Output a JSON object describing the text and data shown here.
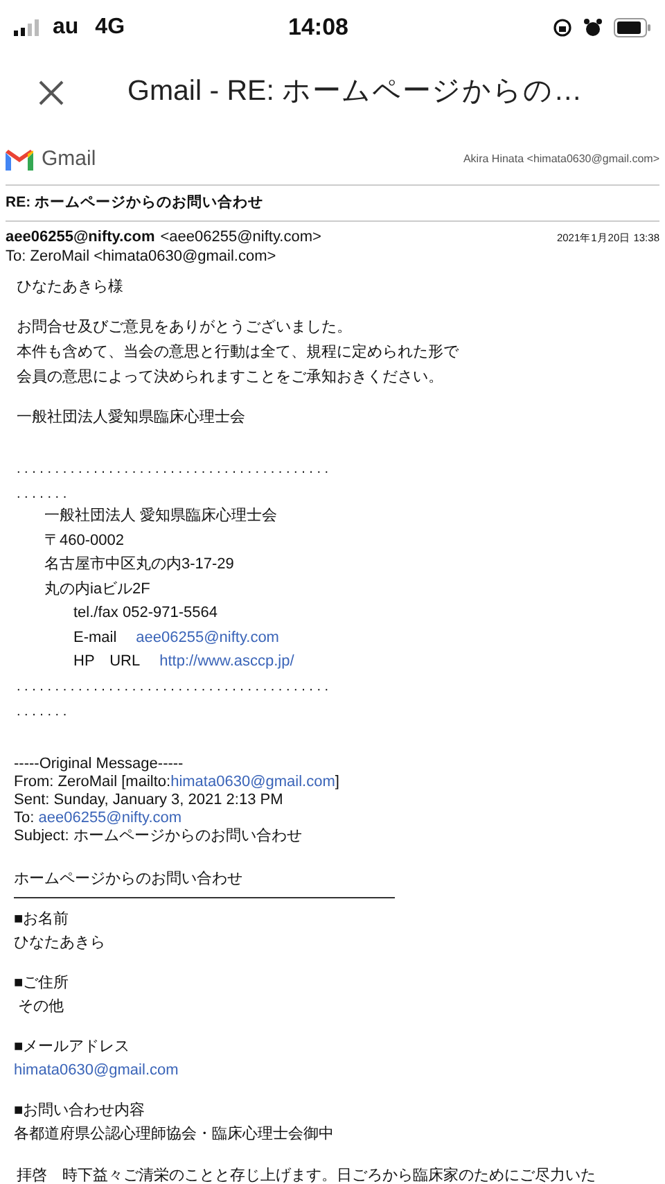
{
  "status_bar": {
    "carrier": "au",
    "network": "4G",
    "time": "14:08"
  },
  "title_bar": {
    "title": "Gmail - RE: ホームページからの…"
  },
  "gmail_header": {
    "logo_text": "Gmail",
    "account": "Akira Hinata <himata0630@gmail.com>"
  },
  "subject": "RE: ホームページからのお問い合わせ",
  "message": {
    "from_name": "aee06255@nifty.com",
    "from_address": "<aee06255@nifty.com>",
    "date": "2021年1月20日 13:38",
    "to": "To: ZeroMail <himata0630@gmail.com>"
  },
  "body": [
    {
      "kind": "para",
      "lines": [
        "ひなたあきら様"
      ]
    },
    {
      "kind": "para",
      "lines": [
        "お問合せ及びご意見をありがとうございました。",
        "本件も含めて、当会の意思と行動は全て、規程に定められた形で",
        "会員の意思によって決められますことをご承知おきください。"
      ]
    },
    {
      "kind": "para",
      "lines": [
        "一般社団法人愛知県臨床心理士会"
      ]
    },
    {
      "kind": "dots",
      "lines": [
        ". . . . . . . . . . . . . . . . . . . . . . . . . . . . . . . . . . . . . . . . .",
        ". . . . . . ."
      ]
    },
    {
      "kind": "signature",
      "lines": [
        {
          "kind": "address",
          "text": "一般社団法人 愛知県臨床心理士会"
        },
        {
          "kind": "address",
          "text": "〒460-0002"
        },
        {
          "kind": "address",
          "text": "名古屋市中区丸の内3-17-29"
        },
        {
          "kind": "address",
          "text": "丸の内iaビル2F"
        },
        {
          "kind": "contact",
          "text": "tel./fax 052-971-5564"
        },
        {
          "kind": "contact",
          "text": "E-mail",
          "link": "aee06255@nifty.com"
        },
        {
          "kind": "contact",
          "text": "HP　URL",
          "link": "http://www.asccp.jp/"
        }
      ]
    },
    {
      "kind": "dots",
      "lines": [
        ". . . . . . . . . . . . . . . . . . . . . . . . . . . . . . . . . . . . . . . . .",
        ". . . . . . ."
      ]
    },
    {
      "kind": "original",
      "lines": [
        [
          {
            "text": "-----Original Message-----",
            "link": false
          }
        ],
        [
          {
            "text": "From: ZeroMail [mailto:",
            "link": false
          },
          {
            "text": "himata0630@gmail.com",
            "link": true
          },
          {
            "text": "]",
            "link": false
          }
        ],
        [
          {
            "text": "Sent: Sunday, January 3, 2021 2:13 PM",
            "link": false
          }
        ],
        [
          {
            "text": "To: ",
            "link": false
          },
          {
            "text": "aee06255@nifty.com",
            "link": true
          }
        ],
        [
          {
            "text": "Subject: ホームページからのお問い合わせ",
            "link": false
          }
        ]
      ]
    },
    {
      "kind": "heading",
      "text": "ホームページからのお問い合わせ"
    },
    {
      "kind": "field",
      "label": "■お名前",
      "value": "ひなたあきら",
      "link": false
    },
    {
      "kind": "field",
      "label": "■ご住所",
      "value": " その他",
      "link": false
    },
    {
      "kind": "field",
      "label": "■メールアドレス",
      "value": "himata0630@gmail.com",
      "link": true
    },
    {
      "kind": "field",
      "label": "■お問い合わせ内容",
      "value": "各都道府県公認心理師協会・臨床心理士会御中",
      "link": false
    },
    {
      "kind": "para",
      "lines": [
        "拝啓　時下益々ご清栄のことと存じ上げます。日ごろから臨床家のためにご尽力いた"
      ]
    }
  ]
}
